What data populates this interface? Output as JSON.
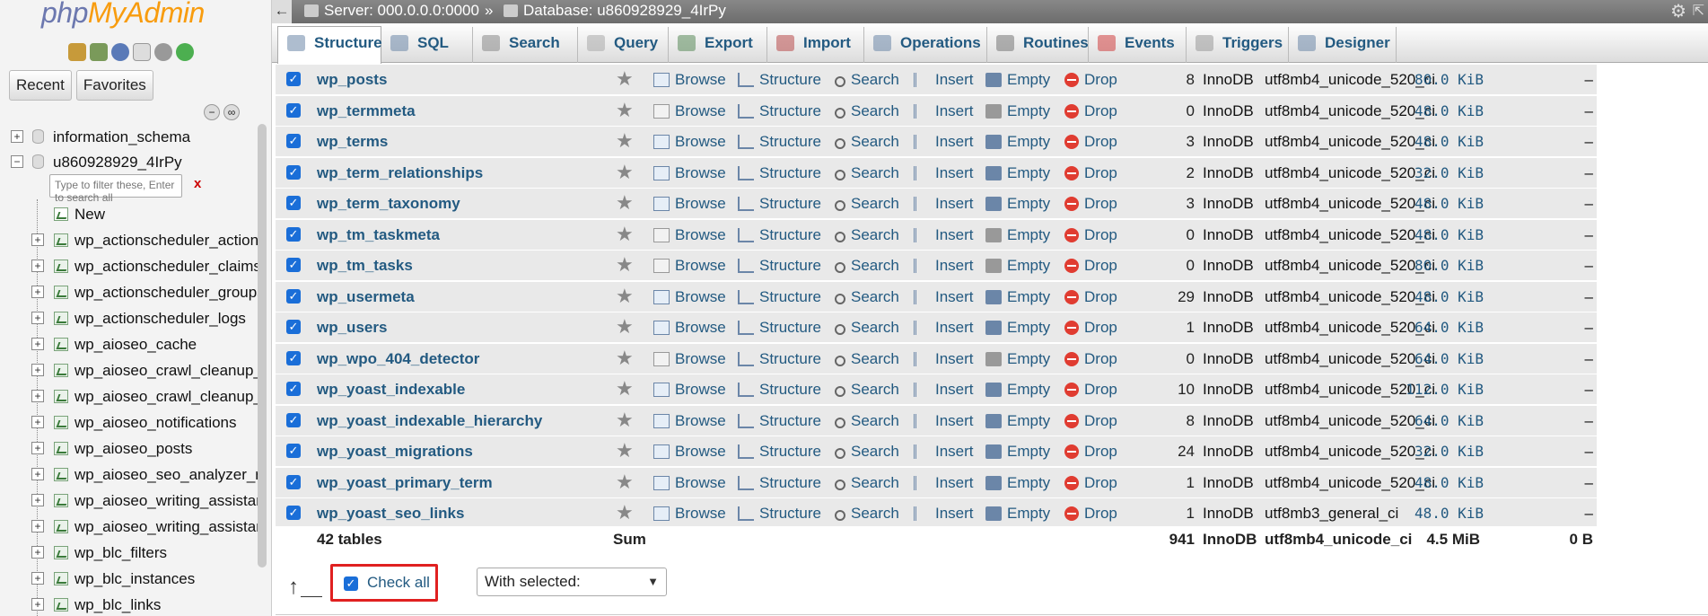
{
  "nav": {
    "logo_php": "php",
    "logo_myadmin": "MyAdmin",
    "tab_recent": "Recent",
    "tab_favorites": "Favorites",
    "filter_placeholder": "Type to filter these, Enter to search all",
    "filter_clear": "x",
    "databases": [
      {
        "name": "information_schema",
        "expanded": false
      },
      {
        "name": "u860928929_4IrPy",
        "expanded": true
      }
    ],
    "new_label": "New",
    "tables": [
      "wp_actionscheduler_actions",
      "wp_actionscheduler_claims",
      "wp_actionscheduler_groups",
      "wp_actionscheduler_logs",
      "wp_aioseo_cache",
      "wp_aioseo_crawl_cleanup_",
      "wp_aioseo_crawl_cleanup_",
      "wp_aioseo_notifications",
      "wp_aioseo_posts",
      "wp_aioseo_seo_analyzer_r",
      "wp_aioseo_writing_assistar",
      "wp_aioseo_writing_assistar",
      "wp_blc_filters",
      "wp_blc_instances",
      "wp_blc_links"
    ]
  },
  "topbar": {
    "back": "←",
    "server": "Server: 000.0.0.0:0000",
    "sep": "»",
    "database": "Database: u860928929_4IrPy"
  },
  "tabs": [
    "Structure",
    "SQL",
    "Search",
    "Query",
    "Export",
    "Import",
    "Operations",
    "Routines",
    "Events",
    "Triggers",
    "Designer"
  ],
  "actions": {
    "browse": "Browse",
    "structure": "Structure",
    "search": "Search",
    "insert": "Insert",
    "empty": "Empty",
    "drop": "Drop"
  },
  "rows": [
    {
      "name": "wp_posts",
      "rows": "8",
      "engine": "InnoDB",
      "collation": "utf8mb4_unicode_520_ci",
      "size": "80.0 KiB",
      "overhead": "–",
      "has_data": true
    },
    {
      "name": "wp_termmeta",
      "rows": "0",
      "engine": "InnoDB",
      "collation": "utf8mb4_unicode_520_ci",
      "size": "48.0 KiB",
      "overhead": "–",
      "has_data": false
    },
    {
      "name": "wp_terms",
      "rows": "3",
      "engine": "InnoDB",
      "collation": "utf8mb4_unicode_520_ci",
      "size": "48.0 KiB",
      "overhead": "–",
      "has_data": true
    },
    {
      "name": "wp_term_relationships",
      "rows": "2",
      "engine": "InnoDB",
      "collation": "utf8mb4_unicode_520_ci",
      "size": "32.0 KiB",
      "overhead": "–",
      "has_data": true
    },
    {
      "name": "wp_term_taxonomy",
      "rows": "3",
      "engine": "InnoDB",
      "collation": "utf8mb4_unicode_520_ci",
      "size": "48.0 KiB",
      "overhead": "–",
      "has_data": true
    },
    {
      "name": "wp_tm_taskmeta",
      "rows": "0",
      "engine": "InnoDB",
      "collation": "utf8mb4_unicode_520_ci",
      "size": "48.0 KiB",
      "overhead": "–",
      "has_data": false
    },
    {
      "name": "wp_tm_tasks",
      "rows": "0",
      "engine": "InnoDB",
      "collation": "utf8mb4_unicode_520_ci",
      "size": "80.0 KiB",
      "overhead": "–",
      "has_data": false
    },
    {
      "name": "wp_usermeta",
      "rows": "29",
      "engine": "InnoDB",
      "collation": "utf8mb4_unicode_520_ci",
      "size": "48.0 KiB",
      "overhead": "–",
      "has_data": true
    },
    {
      "name": "wp_users",
      "rows": "1",
      "engine": "InnoDB",
      "collation": "utf8mb4_unicode_520_ci",
      "size": "64.0 KiB",
      "overhead": "–",
      "has_data": true
    },
    {
      "name": "wp_wpo_404_detector",
      "rows": "0",
      "engine": "InnoDB",
      "collation": "utf8mb4_unicode_520_ci",
      "size": "64.0 KiB",
      "overhead": "–",
      "has_data": false
    },
    {
      "name": "wp_yoast_indexable",
      "rows": "10",
      "engine": "InnoDB",
      "collation": "utf8mb4_unicode_520_ci",
      "size": "112.0 KiB",
      "overhead": "–",
      "has_data": true
    },
    {
      "name": "wp_yoast_indexable_hierarchy",
      "rows": "8",
      "engine": "InnoDB",
      "collation": "utf8mb4_unicode_520_ci",
      "size": "64.0 KiB",
      "overhead": "–",
      "has_data": true
    },
    {
      "name": "wp_yoast_migrations",
      "rows": "24",
      "engine": "InnoDB",
      "collation": "utf8mb4_unicode_520_ci",
      "size": "32.0 KiB",
      "overhead": "–",
      "has_data": true
    },
    {
      "name": "wp_yoast_primary_term",
      "rows": "1",
      "engine": "InnoDB",
      "collation": "utf8mb4_unicode_520_ci",
      "size": "48.0 KiB",
      "overhead": "–",
      "has_data": true
    },
    {
      "name": "wp_yoast_seo_links",
      "rows": "1",
      "engine": "InnoDB",
      "collation": "utf8mb3_general_ci",
      "size": "48.0 KiB",
      "overhead": "–",
      "has_data": true
    }
  ],
  "summary": {
    "tables": "42 tables",
    "label": "Sum",
    "rows": "941",
    "engine": "InnoDB",
    "collation": "utf8mb4_unicode_ci",
    "size": "4.5 MiB",
    "overhead": "0 B"
  },
  "footer": {
    "check_all": "Check all",
    "with_selected": "With selected:"
  },
  "colors": {
    "link": "#235a81",
    "checkbox": "#1a6ed8",
    "highlight_border": "#e02020",
    "drop_icon": "#e03c31",
    "logo_php": "#6c78af",
    "logo_myadmin": "#f89c0e"
  }
}
